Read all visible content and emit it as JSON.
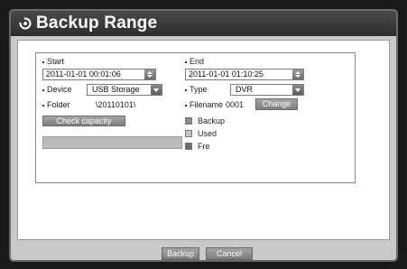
{
  "dialog": {
    "title": "Backup Range"
  },
  "range": {
    "start_label": "Start",
    "start_value": "2011-01-01 00:01:06",
    "end_label": "End",
    "end_value": "2011-01-01 01:10:25",
    "device_label": "Device",
    "device_value": "USB Storage",
    "type_label": "Type",
    "type_value": "DVR",
    "folder_label": "Folder",
    "folder_value": "\\20110101\\",
    "filename_label": "Filename",
    "filename_value": "0001",
    "change_button": "Change",
    "check_capacity_button": "Check capacity"
  },
  "legend": {
    "items": [
      {
        "label": "Backup",
        "color": "#8a8a8a"
      },
      {
        "label": "Used",
        "color": "#c4c4c4"
      },
      {
        "label": "Fre",
        "color": "#6a6a6a"
      }
    ]
  },
  "footer": {
    "backup_button": "Backup",
    "cancel_button": "Cancel"
  },
  "colors": {
    "titlebar": "#3a3a3a",
    "panel": "#c9c9c9",
    "accent": "#7e7e7e"
  }
}
